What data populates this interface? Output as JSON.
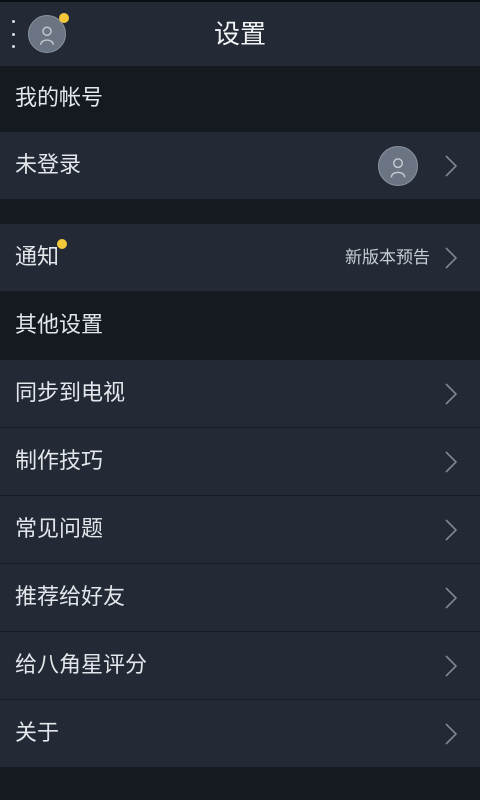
{
  "header": {
    "title": "设置",
    "menu_icon": "overflow-menu-icon",
    "avatar_icon": "user-avatar-icon",
    "notification_dot_color": "#f3c93b"
  },
  "sections": {
    "account": {
      "title": "我的帐号",
      "login_label": "未登录"
    },
    "notification": {
      "label": "通知",
      "value": "新版本预告"
    },
    "other": {
      "title": "其他设置",
      "items": [
        {
          "label": "同步到电视"
        },
        {
          "label": "制作技巧"
        },
        {
          "label": "常见问题"
        },
        {
          "label": "推荐给好友"
        },
        {
          "label": "给八角星评分"
        },
        {
          "label": "关于"
        }
      ]
    }
  },
  "colors": {
    "background": "#1c2129",
    "row": "#232a35",
    "section_header": "#151a21",
    "text": "#e3e6ea",
    "accent_dot": "#f3c93b"
  }
}
